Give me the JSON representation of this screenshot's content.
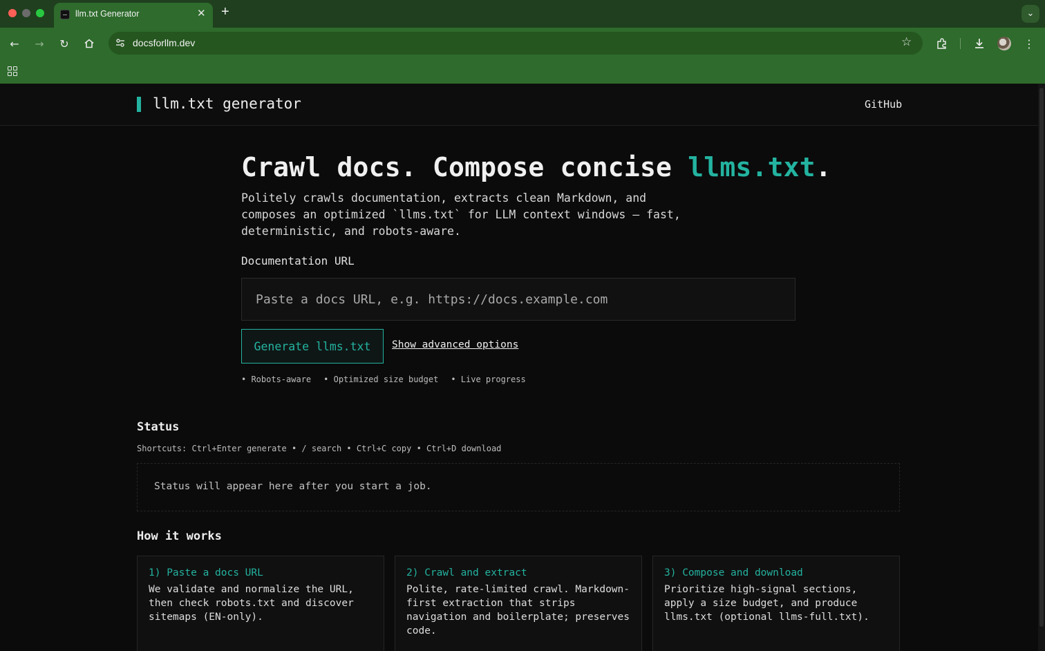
{
  "browser": {
    "tab_title": "llm.txt Generator",
    "url": "docsforllm.dev"
  },
  "header": {
    "brand": "llm.txt generator",
    "github_label": "GitHub"
  },
  "hero": {
    "title_main": "Crawl docs. Compose concise ",
    "title_accent": "llms.txt",
    "title_end": ".",
    "subtitle": "Politely crawls documentation, extracts clean Markdown, and composes an optimized `llms.txt` for LLM context windows — fast, deterministic, and robots-aware."
  },
  "form": {
    "url_label": "Documentation URL",
    "url_placeholder": "Paste a docs URL, e.g. https://docs.example.com",
    "url_value": "",
    "generate_label": "Generate llms.txt",
    "advanced_label": "Show advanced options",
    "features": [
      "• Robots-aware",
      "• Optimized size budget",
      "• Live progress"
    ]
  },
  "status": {
    "heading": "Status",
    "shortcuts": "Shortcuts: Ctrl+Enter generate • / search • Ctrl+C copy • Ctrl+D download",
    "placeholder": "Status will appear here after you start a job."
  },
  "how": {
    "heading": "How it works",
    "steps": [
      {
        "title": "1) Paste a docs URL",
        "body": "We validate and normalize the URL, then check robots.txt and discover sitemaps (EN-only)."
      },
      {
        "title": "2) Crawl and extract",
        "body": "Polite, rate-limited crawl. Markdown-first extraction that strips navigation and boilerplate; preserves code."
      },
      {
        "title": "3) Compose and download",
        "body": "Prioritize high-signal sections, apply a size budget, and produce llms.txt (optional llms-full.txt)."
      }
    ]
  },
  "colors": {
    "accent": "#23b3a0",
    "background": "#0b0b0b",
    "chrome": "#2e6b2c"
  }
}
